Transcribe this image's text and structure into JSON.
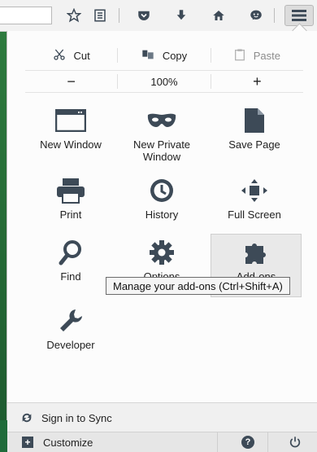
{
  "toolbar": {
    "buttons": [
      {
        "name": "bookmark-star-icon"
      },
      {
        "name": "reading-list-icon"
      },
      {
        "name": "pocket-icon"
      },
      {
        "name": "downloads-icon"
      },
      {
        "name": "home-icon"
      },
      {
        "name": "hello-chat-icon"
      },
      {
        "name": "hamburger-menu-icon"
      }
    ]
  },
  "panel": {
    "edit": {
      "cut": "Cut",
      "copy": "Copy",
      "paste": "Paste"
    },
    "zoom": {
      "minus": "−",
      "level": "100%",
      "plus": "+"
    },
    "items": [
      {
        "id": "new-window",
        "label": "New Window"
      },
      {
        "id": "new-private-window",
        "label": "New Private Window"
      },
      {
        "id": "save-page",
        "label": "Save Page"
      },
      {
        "id": "print",
        "label": "Print"
      },
      {
        "id": "history",
        "label": "History"
      },
      {
        "id": "full-screen",
        "label": "Full Screen"
      },
      {
        "id": "find",
        "label": "Find"
      },
      {
        "id": "options",
        "label": "Options"
      },
      {
        "id": "add-ons",
        "label": "Add-ons"
      },
      {
        "id": "developer",
        "label": "Developer"
      }
    ],
    "tooltip": "Manage your add-ons (Ctrl+Shift+A)",
    "sync_label": "Sign in to Sync",
    "customize_label": "Customize"
  },
  "colors": {
    "icon": "#3d4a57",
    "panel_bg": "#fcfcfc"
  }
}
